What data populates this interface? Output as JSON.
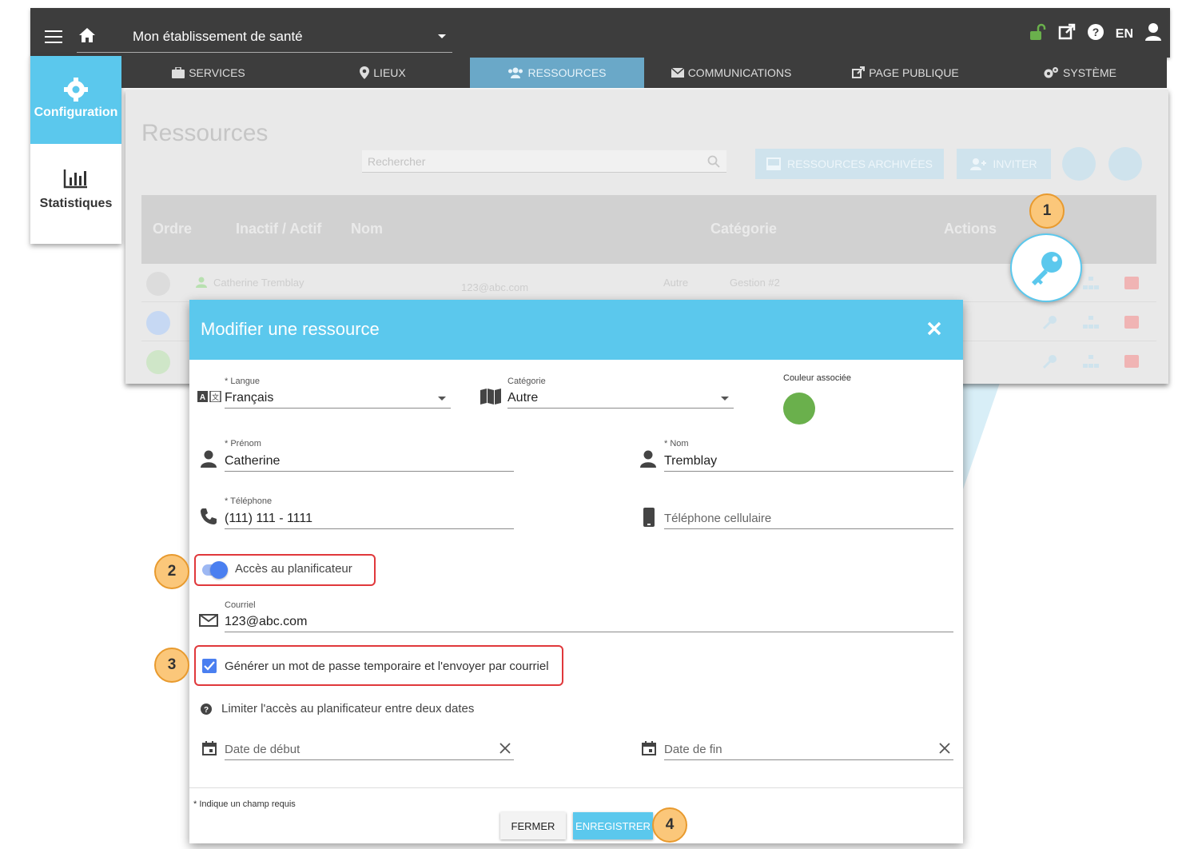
{
  "topbar": {
    "establishment": "Mon établissement de santé",
    "language": "EN",
    "icons": [
      "menu-icon",
      "home-icon",
      "unlock-icon",
      "external-link-icon",
      "help-icon",
      "user-icon"
    ]
  },
  "sidebar": {
    "items": [
      {
        "label": "Configuration",
        "icon": "gear-icon",
        "active": true
      },
      {
        "label": "Statistiques",
        "icon": "bar-chart-icon",
        "active": false
      }
    ]
  },
  "nav": {
    "tabs": [
      {
        "label": "SERVICES",
        "icon": "briefcase-icon"
      },
      {
        "label": "LIEUX",
        "icon": "map-pin-icon"
      },
      {
        "label": "RESSOURCES",
        "icon": "users-icon",
        "active": true
      },
      {
        "label": "COMMUNICATIONS",
        "icon": "envelope-icon"
      },
      {
        "label": "PAGE PUBLIQUE",
        "icon": "external-link-icon"
      },
      {
        "label": "SYSTÈME",
        "icon": "cogs-icon"
      }
    ]
  },
  "resources_page": {
    "title": "Ressources",
    "search_placeholder": "Rechercher",
    "archived_button": "RESSOURCES ARCHIVÉES",
    "invite_button": "INVITER",
    "columns": [
      "Ordre",
      "Inactif / Actif",
      "Nom",
      "Catégorie",
      "Actions"
    ],
    "rows": [
      {
        "name": "Catherine Tremblay",
        "email": "123@abc.com",
        "category": "Autre",
        "group": "Gestion #2"
      }
    ]
  },
  "callouts": [
    "1",
    "2",
    "3",
    "4"
  ],
  "modal": {
    "title": "Modifier une ressource",
    "language_label": "* Langue",
    "language_value": "Français",
    "category_label": "Catégorie",
    "category_value": "Autre",
    "color_label": "Couleur associée",
    "color_value": "#6ab04c",
    "firstname_label": "* Prénom",
    "firstname_value": "Catherine",
    "lastname_label": "* Nom",
    "lastname_value": "Tremblay",
    "phone_label": "* Téléphone",
    "phone_value": "(111) 111 - 1111",
    "mobile_placeholder": "Téléphone cellulaire",
    "scheduler_access_label": "Accès au planificateur",
    "scheduler_access_on": true,
    "email_label": "Courriel",
    "email_value": "123@abc.com",
    "temp_password_label": "Générer un mot de passe temporaire et l'envoyer par courriel",
    "temp_password_checked": true,
    "limit_access_label": "Limiter l'accès au planificateur entre deux dates",
    "start_date_placeholder": "Date de début",
    "end_date_placeholder": "Date de fin",
    "required_note": "* Indique un champ requis",
    "close_button": "FERMER",
    "save_button": "ENREGISTRER"
  },
  "colors": {
    "accent": "#5bc8ed",
    "topbar": "#3d3d3d",
    "toggle": "#4a7ff0",
    "highlight": "#e0383b",
    "callout": "#fbc77a"
  }
}
